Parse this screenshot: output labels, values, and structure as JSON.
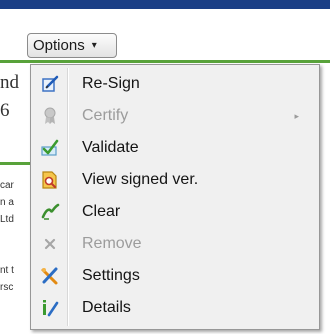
{
  "options_button": {
    "label": "Options",
    "caret": "▾"
  },
  "background": {
    "big_lines": [
      "nd",
      "6"
    ],
    "small_lines": [
      "car",
      "n a",
      "Ltd",
      "nt t",
      "rsc"
    ]
  },
  "menu": {
    "items": [
      {
        "label": "Re-Sign",
        "icon": "re-sign-icon",
        "enabled": true
      },
      {
        "label": "Certify",
        "icon": "certify-icon",
        "enabled": false,
        "submenu_arrow": "▸"
      },
      {
        "label": "Validate",
        "icon": "validate-icon",
        "enabled": true
      },
      {
        "label": "View signed ver.",
        "icon": "view-signed-version-icon",
        "enabled": true
      },
      {
        "label": "Clear",
        "icon": "clear-icon",
        "enabled": true
      },
      {
        "label": "Remove",
        "icon": "remove-icon",
        "enabled": false
      },
      {
        "label": "Settings",
        "icon": "settings-icon",
        "enabled": true
      },
      {
        "label": "Details",
        "icon": "details-icon",
        "enabled": true
      }
    ]
  },
  "colors": {
    "header_bar": "#1b3f86",
    "accent_line": "#58a23a",
    "menu_background": "#f0f0f0",
    "disabled_text": "#9c9c9c"
  }
}
